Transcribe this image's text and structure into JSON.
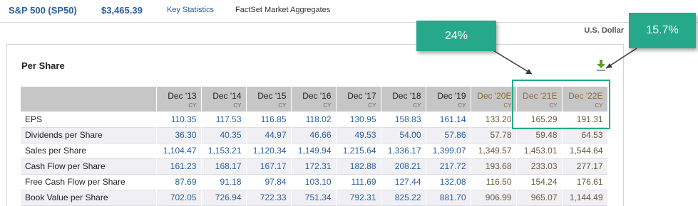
{
  "header": {
    "ticker": "S&P 500 (SP50)",
    "price": "$3,465.39",
    "links": [
      "Key Statistics",
      "FactSet Market Aggregates"
    ],
    "currency": "U.S. Dollar"
  },
  "panel": {
    "title": "Per Share",
    "download_icon": "download-icon"
  },
  "table": {
    "columns": [
      {
        "label": "Dec '13",
        "sub": "CY",
        "estimate": false
      },
      {
        "label": "Dec '14",
        "sub": "CY",
        "estimate": false
      },
      {
        "label": "Dec '15",
        "sub": "CY",
        "estimate": false
      },
      {
        "label": "Dec '16",
        "sub": "CY",
        "estimate": false
      },
      {
        "label": "Dec '17",
        "sub": "CY",
        "estimate": false
      },
      {
        "label": "Dec '18",
        "sub": "CY",
        "estimate": false
      },
      {
        "label": "Dec '19",
        "sub": "CY",
        "estimate": false
      },
      {
        "label": "Dec '20E",
        "sub": "CY",
        "estimate": true
      },
      {
        "label": "Dec '21E",
        "sub": "CY",
        "estimate": true
      },
      {
        "label": "Dec '22E",
        "sub": "CY",
        "estimate": true
      }
    ],
    "rows": [
      {
        "label": "EPS",
        "values": [
          "110.35",
          "117.53",
          "116.85",
          "118.02",
          "130.95",
          "158.83",
          "161.14",
          "133.20",
          "165.29",
          "191.31"
        ]
      },
      {
        "label": "Dividends per Share",
        "values": [
          "36.30",
          "40.35",
          "44.97",
          "46.66",
          "49.53",
          "54.00",
          "57.86",
          "57.78",
          "59.48",
          "64.53"
        ]
      },
      {
        "label": "Sales per Share",
        "values": [
          "1,104.47",
          "1,153.21",
          "1,120.34",
          "1,149.94",
          "1,215.64",
          "1,336.17",
          "1,399.07",
          "1,349.57",
          "1,453.01",
          "1,544.64"
        ]
      },
      {
        "label": "Cash Flow per Share",
        "values": [
          "161.23",
          "168.17",
          "167.17",
          "172.31",
          "182.88",
          "208.21",
          "217.72",
          "193.68",
          "233.03",
          "277.17"
        ]
      },
      {
        "label": "Free Cash Flow per Share",
        "values": [
          "87.69",
          "91.18",
          "97.84",
          "103.10",
          "111.69",
          "127.44",
          "132.08",
          "116.50",
          "154.24",
          "176.61"
        ]
      },
      {
        "label": "Book Value per Share",
        "values": [
          "702.05",
          "726.94",
          "722.33",
          "751.34",
          "792.31",
          "825.22",
          "881.70",
          "906.99",
          "965.07",
          "1,144.49"
        ]
      }
    ]
  },
  "annotations": {
    "callout_left": "24%",
    "callout_right": "15.7%",
    "color": "#26a98a"
  }
}
